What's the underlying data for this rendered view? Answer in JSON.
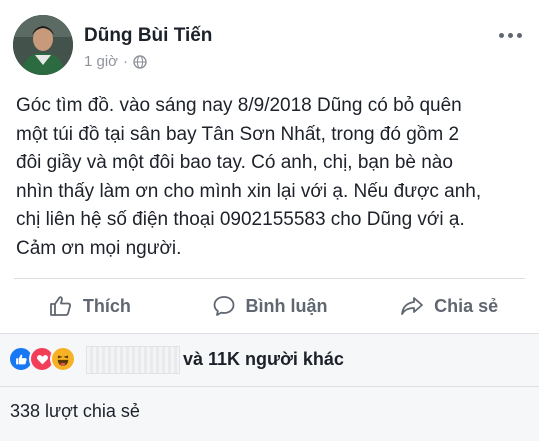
{
  "post": {
    "author": "Dũng Bùi Tiến",
    "time": "1 giờ",
    "separator": "·",
    "lines": [
      "Góc tìm đồ. vào sáng nay 8/9/2018 Dũng có bỏ quên",
      "một túi đồ tại sân bay Tân Sơn Nhất, trong đó gồm 2",
      "đôi giầy và một đôi bao tay. Có anh, chị, bạn bè nào",
      "nhìn thấy làm ơn cho mình xin lại với ạ. Nếu được anh,",
      "chị liên hệ số điện thoại 0902155583 cho Dũng với ạ.",
      "Cảm ơn mọi người."
    ]
  },
  "actions": {
    "like": "Thích",
    "comment": "Bình luận",
    "share": "Chia sẻ"
  },
  "reactions": {
    "summary": "và 11K người khác",
    "icons": [
      "like-reaction-icon",
      "love-reaction-icon",
      "haha-reaction-icon"
    ],
    "colors": {
      "like": "#1877f2",
      "love": "#f33e58",
      "haha": "#f7b125"
    }
  },
  "shares": {
    "text": "338 lượt chia sẻ"
  }
}
